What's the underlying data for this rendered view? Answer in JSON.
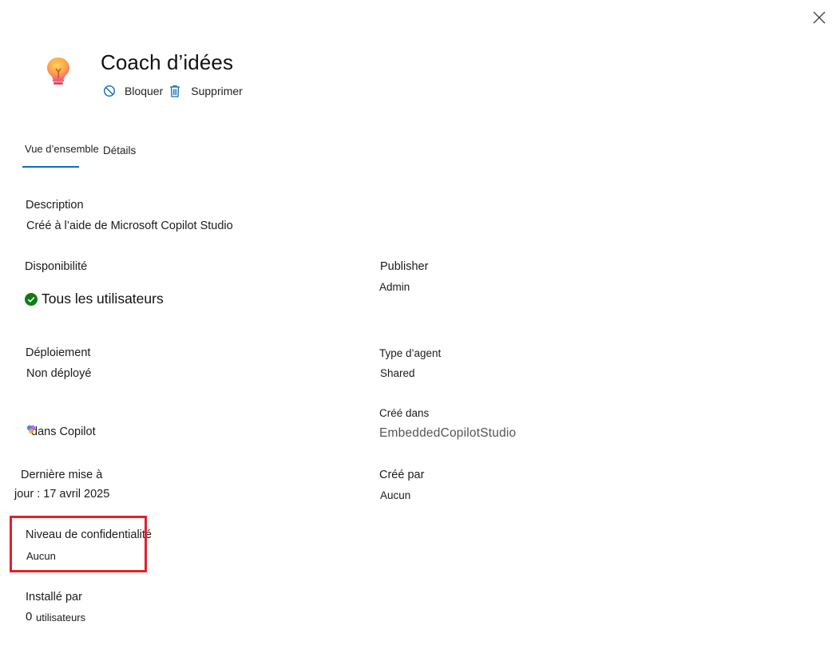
{
  "header": {
    "title": "Coach d’idées",
    "close_icon": "close-icon",
    "app_icon": "lightbulb-icon"
  },
  "actions": {
    "block_label": "Bloquer",
    "block_icon": "block-icon",
    "delete_label": "Supprimer",
    "delete_icon": "trash-icon"
  },
  "tabs": [
    {
      "label": "Vue d’ensemble",
      "selected": true
    },
    {
      "label": "Détails",
      "selected": false
    }
  ],
  "fields": {
    "description": {
      "label": "Description",
      "value": "Créé à l’aide de Microsoft Copilot Studio"
    },
    "availability": {
      "label": "Disponibilité",
      "value": "Tous les utilisateurs"
    },
    "publisher": {
      "label": "Publisher",
      "value": "Admin"
    },
    "deployment": {
      "label": "Déploiement",
      "value": "Non déployé"
    },
    "agent_type": {
      "label": "Type d’agent",
      "value": "Shared"
    },
    "created_in": {
      "label": "Créé dans",
      "value": "EmbeddedCopilotStudio"
    },
    "copilot": {
      "value": "dans Copilot"
    },
    "last_update": {
      "label_line1": "Dernière mise à",
      "label_line2": "jour : 17 avril 2025"
    },
    "created_by": {
      "label": "Créé par",
      "value": "Aucun"
    },
    "sensitivity": {
      "label": "Niveau de confidentialité",
      "value": "Aucun"
    },
    "installed_by": {
      "label": "Installé par",
      "count": "0",
      "unit": "utilisateurs"
    }
  },
  "colors": {
    "accent": "#0f6cbd",
    "success": "#107c10",
    "highlight": "#e3202d"
  }
}
